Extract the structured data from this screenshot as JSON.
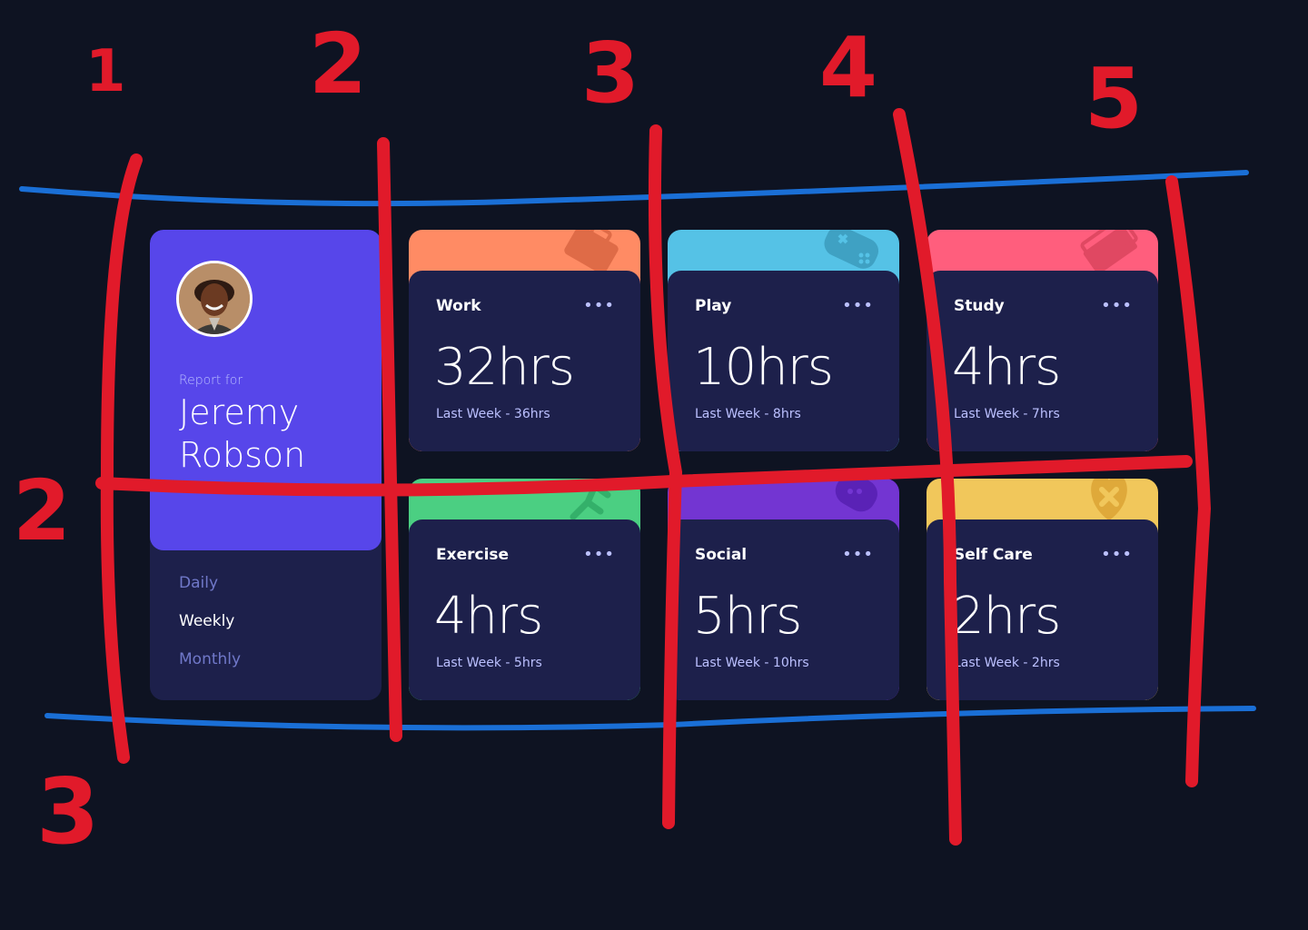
{
  "profile": {
    "report_for": "Report for",
    "name": "Jeremy Robson",
    "periods": [
      {
        "label": "Daily",
        "active": false
      },
      {
        "label": "Weekly",
        "active": true
      },
      {
        "label": "Monthly",
        "active": false
      }
    ]
  },
  "activities": [
    {
      "title": "Work",
      "current": "32hrs",
      "previous": "Last Week - 36hrs",
      "color": "#ff8b64",
      "icon": "briefcase-icon",
      "icon_color": "#df6b47"
    },
    {
      "title": "Play",
      "current": "10hrs",
      "previous": "Last Week - 8hrs",
      "color": "#55c2e6",
      "icon": "gamepad-icon",
      "icon_color": "#3fa1c3"
    },
    {
      "title": "Study",
      "current": "4hrs",
      "previous": "Last Week - 7hrs",
      "color": "#ff5e7d",
      "icon": "book-icon",
      "icon_color": "#e04862"
    },
    {
      "title": "Exercise",
      "current": "4hrs",
      "previous": "Last Week - 5hrs",
      "color": "#4bcf82",
      "icon": "running-icon",
      "icon_color": "#34b06a"
    },
    {
      "title": "Social",
      "current": "5hrs",
      "previous": "Last Week - 10hrs",
      "color": "#7335d2",
      "icon": "chat-icon",
      "icon_color": "#5a22b6"
    },
    {
      "title": "Self Care",
      "current": "2hrs",
      "previous": "Last Week - 2hrs",
      "color": "#f1c75b",
      "icon": "heart-icon",
      "icon_color": "#dfa93a"
    }
  ],
  "menu_glyph": "•••",
  "annotation": {
    "column_numbers": [
      "1",
      "2",
      "3",
      "4",
      "5"
    ],
    "row_numbers": [
      "2",
      "3"
    ],
    "grid_line_color": "#e11a2a",
    "row_line_color": "#1a6fd6"
  }
}
